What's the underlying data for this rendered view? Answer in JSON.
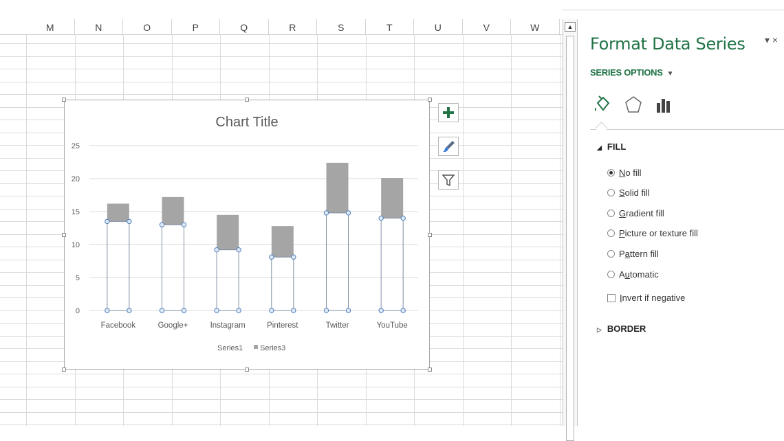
{
  "sheet": {
    "columns": [
      "M",
      "N",
      "O",
      "P",
      "Q",
      "R",
      "S",
      "T",
      "U",
      "V",
      "W"
    ]
  },
  "chart_buttons": [
    {
      "name": "chart-elements-button",
      "icon": "plus-icon"
    },
    {
      "name": "chart-styles-button",
      "icon": "paintbrush-icon"
    },
    {
      "name": "chart-filters-button",
      "icon": "funnel-icon"
    }
  ],
  "chart_data": {
    "type": "bar",
    "stacked": true,
    "title": "Chart Title",
    "categories": [
      "Facebook",
      "Google+",
      "Instagram",
      "Pinterest",
      "Twitter",
      "YouTube"
    ],
    "series": [
      {
        "name": "Series1",
        "values": [
          13.5,
          13,
          9.2,
          8.1,
          14.8,
          14
        ],
        "fill": "none",
        "color": "#7f8ca3"
      },
      {
        "name": "Series3",
        "values": [
          2.7,
          4.2,
          5.3,
          4.7,
          7.6,
          6.1
        ],
        "fill": "#a5a5a5",
        "color": "#a5a5a5"
      }
    ],
    "ylim": [
      0,
      25
    ],
    "yticks": [
      "0",
      "5",
      "10",
      "15",
      "20",
      "25"
    ],
    "grid": true,
    "legend": "bottom",
    "legend_entries": [
      "Series1",
      "Series3"
    ]
  },
  "panel": {
    "title": "Format Data Series",
    "controls": "▾ ×",
    "series_options_label": "SERIES OPTIONS",
    "series_options_arrow": "▼",
    "tabs": [
      {
        "name": "tab-fill-line",
        "icon": "paint-bucket-icon"
      },
      {
        "name": "tab-effects",
        "icon": "pentagon-icon"
      },
      {
        "name": "tab-series-options",
        "icon": "bar-chart-icon"
      }
    ],
    "fill_section": {
      "label": "FILL",
      "arrow": "◢"
    },
    "fill_options": [
      {
        "key": "N",
        "rest": "o fill",
        "selected": true
      },
      {
        "key": "S",
        "rest": "olid fill",
        "selected": false
      },
      {
        "key": "G",
        "rest": "radient fill",
        "selected": false
      },
      {
        "key": "P",
        "rest": "icture or texture fill",
        "selected": false
      },
      {
        "pre": "P",
        "key": "a",
        "rest": "ttern fill",
        "selected": false
      },
      {
        "pre": "A",
        "key": "u",
        "rest": "tomatic",
        "selected": false
      }
    ],
    "invert": {
      "key": "I",
      "rest": "nvert if negative",
      "checked": false
    },
    "border_section": {
      "label": "BORDER",
      "arrow": "▷"
    }
  }
}
